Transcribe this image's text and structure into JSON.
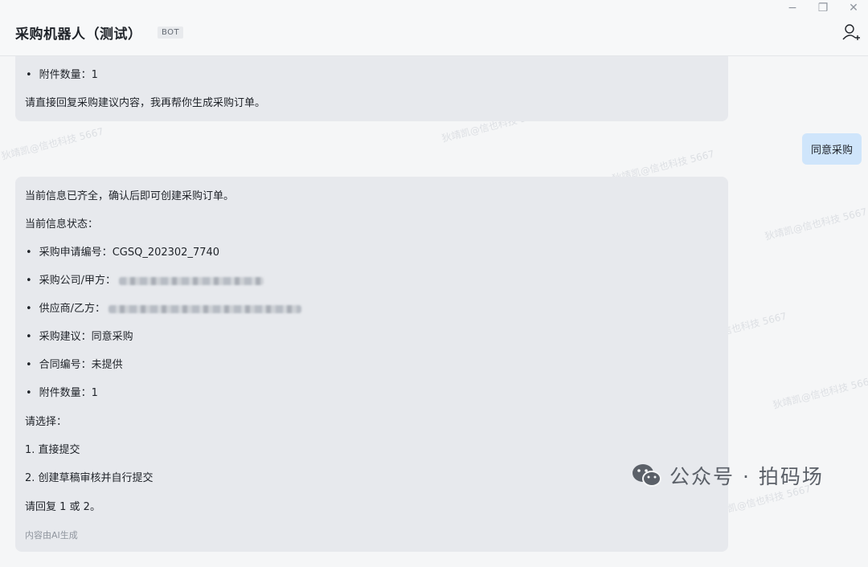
{
  "header": {
    "title": "采购机器人（测试）",
    "badge": "BOT"
  },
  "window": {
    "minimize": "−",
    "restore": "❐",
    "close": "✕"
  },
  "first_message": {
    "attachment_line": "附件数量：1",
    "prompt": "请直接回复采购建议内容，我再帮你生成采购订单。"
  },
  "user_message": "同意采购",
  "second_message": {
    "intro": "当前信息已齐全，确认后即可创建采购订单。",
    "status_heading": "当前信息状态：",
    "request_no_label": "采购申请编号：",
    "request_no_value": "CGSQ_202302_7740",
    "buyer_label": "采购公司/甲方：",
    "supplier_label": "供应商/乙方：",
    "advice_line": "采购建议：同意采购",
    "contract_line": "合同编号：未提供",
    "attachment_line": "附件数量：1",
    "choose": "请选择：",
    "option_1": "1. 直接提交",
    "option_2": "2. 创建草稿审核并自行提交",
    "reply": "请回复 1 或 2。",
    "ai_note": "内容由AI生成"
  },
  "watermark_text": "狄靖凯@信也科技 5667",
  "wechat_mark": "公众号 · 拍码场"
}
